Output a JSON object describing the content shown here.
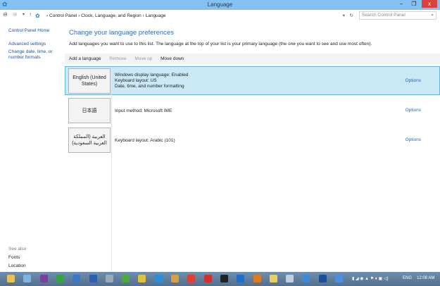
{
  "window": {
    "title": "Language",
    "minimize": "–",
    "restore": "❐",
    "close": "x"
  },
  "address": {
    "crumbs": [
      "Control Panel",
      "Clock, Language, and Region",
      "Language"
    ],
    "search_placeholder": "Search Control Panel"
  },
  "sidebar": {
    "items": [
      "Control Panel Home",
      "Advanced settings",
      "Change date, time, or number formats"
    ],
    "see_also_label": "See also",
    "see_also": [
      "Fonts",
      "Location"
    ]
  },
  "main": {
    "heading": "Change your language preferences",
    "description": "Add languages you want to use to this list. The language at the top of your list is your primary language (the one you want to see and use most often).",
    "toolbar": {
      "add": "Add a language",
      "remove": "Remove",
      "move_up": "Move up",
      "move_down": "Move down"
    },
    "languages": [
      {
        "name": "English (United States)",
        "info": [
          "Windows display language: Enabled",
          "Keyboard layout: US",
          "Date, time, and number formatting"
        ],
        "options": "Options"
      },
      {
        "name": "日本語",
        "info": [
          "Input method: Microsoft IME"
        ],
        "options": "Options"
      },
      {
        "name": "العربية (المملكة العربية السعودية)",
        "info": [
          "Keyboard layout: Arabic (101)"
        ],
        "options": "Options"
      }
    ]
  },
  "taskbar": {
    "language": "ENG",
    "time": "12:08 AM",
    "icon_colors": [
      "#e6c25a",
      "#7fb3e6",
      "#7b3fa0",
      "#3aa04a",
      "#3b78c8",
      "#2b5fb0",
      "#9aaab8",
      "#4caa3a",
      "#e0c040",
      "#2a8fd8",
      "#d8a040",
      "#e04030",
      "#d03030",
      "#222222",
      "#1f6fc8",
      "#e07a20",
      "#e8d060",
      "#c0d0e0",
      "#3a8ad8",
      "#1a4f9a",
      "#4a90e0"
    ]
  }
}
